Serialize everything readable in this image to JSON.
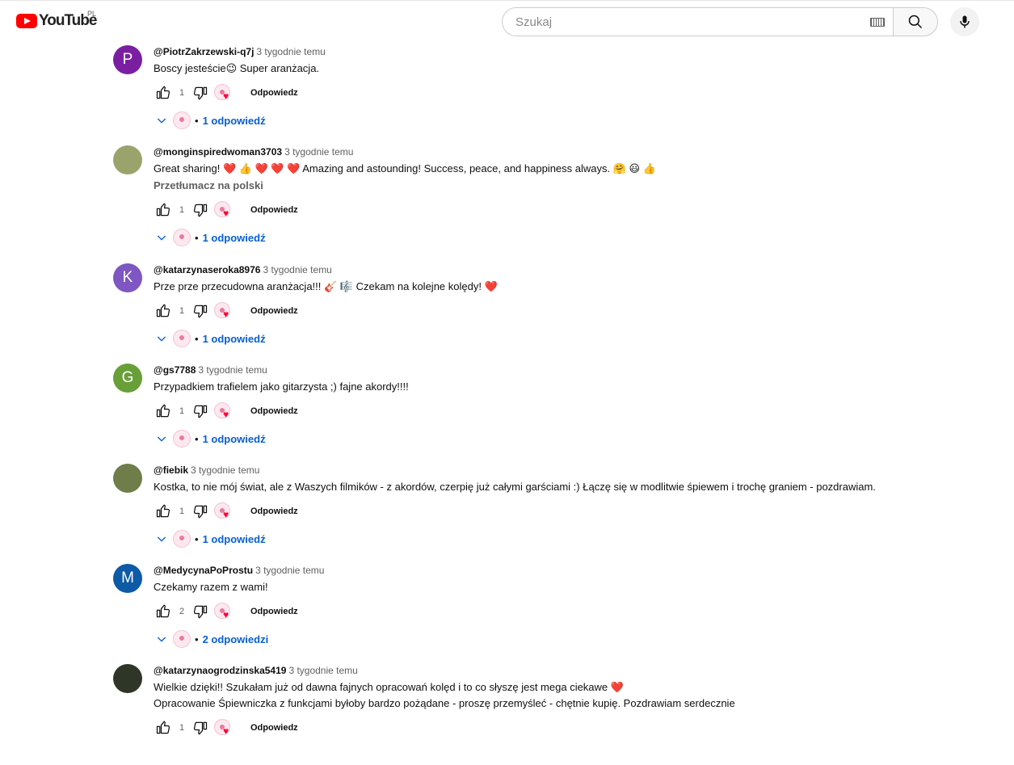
{
  "header": {
    "logo_text": "YouTube",
    "country_code": "PL",
    "search_placeholder": "Szukaj"
  },
  "comments": [
    {
      "author": "@PiotrZakrzewski-q7j",
      "time": "3 tygodnie temu",
      "text": "Boscy jesteście😉  Super aranżacja.",
      "avatar_letter": "P",
      "avatar_color": "#7b1fa2",
      "likes": "1",
      "reply_label": "Odpowiedz",
      "replies_label": "1 odpowiedź",
      "translate": ""
    },
    {
      "author": "@monginspiredwoman3703",
      "time": "3 tygodnie temu",
      "text": "Great sharing! ❤️ 👍 ❤️ ❤️ ❤️ Amazing and astounding! Success, peace, and happiness always. 🤗 😃 👍",
      "avatar_letter": "",
      "avatar_color": "#9aa36b",
      "likes": "1",
      "reply_label": "Odpowiedz",
      "replies_label": "1 odpowiedź",
      "translate": "Przetłumacz na polski"
    },
    {
      "author": "@katarzynaseroka8976",
      "time": "3 tygodnie temu",
      "text": "Prze prze przecudowna aranżacja!!! 🎸 🎼  Czekam na kolejne kolędy! ❤️",
      "avatar_letter": "K",
      "avatar_color": "#7e57c2",
      "likes": "1",
      "reply_label": "Odpowiedz",
      "replies_label": "1 odpowiedź",
      "translate": ""
    },
    {
      "author": "@gs7788",
      "time": "3 tygodnie temu",
      "text": "Przypadkiem trafielem jako gitarzysta ;) fajne akordy!!!!",
      "avatar_letter": "G",
      "avatar_color": "#689f38",
      "likes": "1",
      "reply_label": "Odpowiedz",
      "replies_label": "1 odpowiedź",
      "translate": ""
    },
    {
      "author": "@fiebik",
      "time": "3 tygodnie temu",
      "text": "Kostka, to nie mój świat, ale z Waszych filmików - z akordów, czerpię już całymi garściami :) Łączę się w modlitwie śpiewem i trochę graniem - pozdrawiam.",
      "avatar_letter": "",
      "avatar_color": "#6f7d4a",
      "likes": "1",
      "reply_label": "Odpowiedz",
      "replies_label": "1 odpowiedź",
      "translate": ""
    },
    {
      "author": "@MedycynaPoProstu",
      "time": "3 tygodnie temu",
      "text": "Czekamy razem z wami!",
      "avatar_letter": "M",
      "avatar_color": "#0d5aa7",
      "likes": "2",
      "reply_label": "Odpowiedz",
      "replies_label": "2 odpowiedzi",
      "translate": ""
    },
    {
      "author": "@katarzynaogrodzinska5419",
      "time": "3 tygodnie temu",
      "text": "Wielkie dzięki!! Szukałam już od dawna fajnych opracowań kolęd i to co słyszę jest mega ciekawe ❤️\nOpracowanie Śpiewniczka z funkcjami byłoby bardzo pożądane - proszę przemyśleć - chętnie kupię. Pozdrawiam serdecznie",
      "avatar_letter": "",
      "avatar_color": "#2f3527",
      "likes": "1",
      "reply_label": "Odpowiedz",
      "replies_label": "",
      "translate": ""
    }
  ]
}
